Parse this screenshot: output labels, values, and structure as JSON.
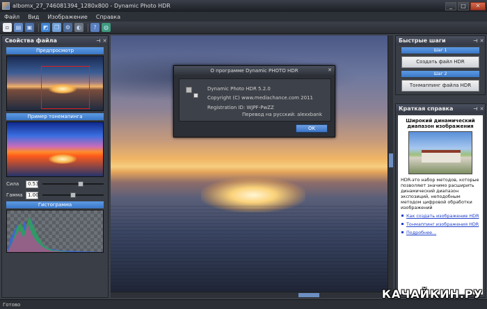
{
  "window": {
    "title": "albomx_27_746081394_1280x800 - Dynamic Photo HDR"
  },
  "menu": {
    "items": [
      "Файл",
      "Вид",
      "Изображение",
      "Справка"
    ]
  },
  "toolbar": {
    "icons": [
      "new-icon",
      "open-icon",
      "save-icon",
      "image-icon",
      "copy-icon",
      "settings-icon",
      "mask-icon",
      "grid-icon",
      "help-icon",
      "globe-icon"
    ]
  },
  "left_panel": {
    "title": "Свойства файла",
    "preview_label": "Предпросмотр",
    "tonemap_label": "Пример тонемапинга",
    "strength_label": "Сила",
    "strength_value": "0.53",
    "strength_level": 0.62,
    "gamma_label": "Гамма",
    "gamma_value": "1.00",
    "gamma_level": 0.5,
    "histogram_label": "Гистограмма"
  },
  "dialog": {
    "title": "О программе Dynamic PHOTO HDR",
    "line1": "Dynamic Photo HDR 5.2.0",
    "line2": "Copyright (C) www.mediachance.com 2011",
    "line3": "Registration ID: WJPF-PwZZ",
    "line4": "Перевод на русский: alexxbank",
    "ok": "OK"
  },
  "right_panel": {
    "quick_title": "Быстрые шаги",
    "step1": "Шаг 1",
    "create_hdr": "Создать файл HDR",
    "step2": "Шаг 2",
    "tonemap_hdr": "Тонмаппинг файла HDR",
    "help_title": "Краткая справка",
    "help_heading": "Широкий динамический диапазон изображения",
    "help_text": "HDR-это набор методов, которые позволяют значимо расширить динамический диапазон экспозиций, неподобным методом цифровой обработки изображений",
    "link1": "Как создать изображение HDR",
    "link2": "Тонмаппинг изображения HDR",
    "link3": "Подробнее..."
  },
  "status": {
    "text": "Готово"
  },
  "watermark": "КАЧАЙКИН.РУ",
  "colors": {
    "accent": "#3a78c9",
    "link": "#1c3ec7",
    "close": "#c0452b"
  }
}
